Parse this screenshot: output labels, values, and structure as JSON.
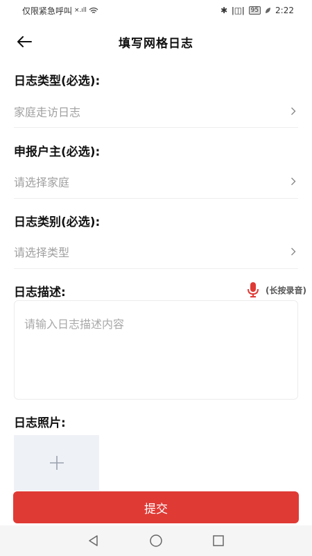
{
  "status_bar": {
    "carrier_text": "仅限紧急呼叫",
    "signal_label": "×.ıll",
    "bluetooth": "✱",
    "vibrate": "ǀ◫ǀ",
    "battery": "95",
    "time": "2:22"
  },
  "header": {
    "title": "填写网格日志"
  },
  "form": {
    "log_type": {
      "label": "日志类型(必选):",
      "value": "家庭走访日志"
    },
    "household": {
      "label": "申报户主(必选):",
      "placeholder": "请选择家庭"
    },
    "log_category": {
      "label": "日志类别(必选):",
      "placeholder": "请选择类型"
    },
    "description": {
      "label": "日志描述:",
      "voice_hint": "(长按录音)",
      "placeholder": "请输入日志描述内容"
    },
    "photos": {
      "label": "日志照片:"
    }
  },
  "submit_label": "提交",
  "colors": {
    "accent": "#e03a35",
    "placeholder": "#a0a0a0",
    "photo_bg": "#eef1f6"
  },
  "icons": {
    "back": "back-arrow-icon",
    "chevron": "chevron-right-icon",
    "mic": "microphone-icon",
    "add": "plus-icon",
    "nav_back": "nav-back-icon",
    "nav_home": "nav-home-icon",
    "nav_recent": "nav-recent-icon"
  }
}
